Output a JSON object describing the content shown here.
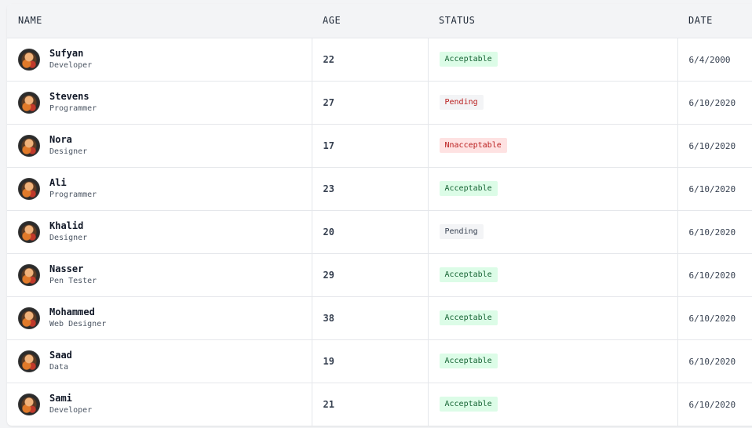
{
  "table": {
    "headers": {
      "name": "NAME",
      "age": "AGE",
      "status": "STATUS",
      "date": "DATE"
    },
    "rows": [
      {
        "name": "Sufyan",
        "role": "Developer",
        "age": "22",
        "status": "Acceptable",
        "status_style": "acceptable",
        "date": "6/4/2000"
      },
      {
        "name": "Stevens",
        "role": "Programmer",
        "age": "27",
        "status": "Pending",
        "status_style": "pending-red",
        "date": "6/10/2020"
      },
      {
        "name": "Nora",
        "role": "Designer",
        "age": "17",
        "status": "Nnacceptable",
        "status_style": "unacceptable",
        "date": "6/10/2020"
      },
      {
        "name": "Ali",
        "role": "Programmer",
        "age": "23",
        "status": "Acceptable",
        "status_style": "acceptable",
        "date": "6/10/2020"
      },
      {
        "name": "Khalid",
        "role": "Designer",
        "age": "20",
        "status": "Pending",
        "status_style": "pending",
        "date": "6/10/2020"
      },
      {
        "name": "Nasser",
        "role": "Pen Tester",
        "age": "29",
        "status": "Acceptable",
        "status_style": "acceptable",
        "date": "6/10/2020"
      },
      {
        "name": "Mohammed",
        "role": "Web Designer",
        "age": "38",
        "status": "Acceptable",
        "status_style": "acceptable",
        "date": "6/10/2020"
      },
      {
        "name": "Saad",
        "role": "Data",
        "age": "19",
        "status": "Acceptable",
        "status_style": "acceptable",
        "date": "6/10/2020"
      },
      {
        "name": "Sami",
        "role": "Developer",
        "age": "21",
        "status": "Acceptable",
        "status_style": "acceptable",
        "date": "6/10/2020"
      }
    ]
  },
  "colors": {
    "acceptable_bg": "#dcfce7",
    "acceptable_text": "#166534",
    "unacceptable_bg": "#fee2e2",
    "unacceptable_text": "#b91c1c",
    "pending_bg": "#f3f4f6"
  },
  "icons": {
    "avatar": "user-avatar-icon"
  }
}
